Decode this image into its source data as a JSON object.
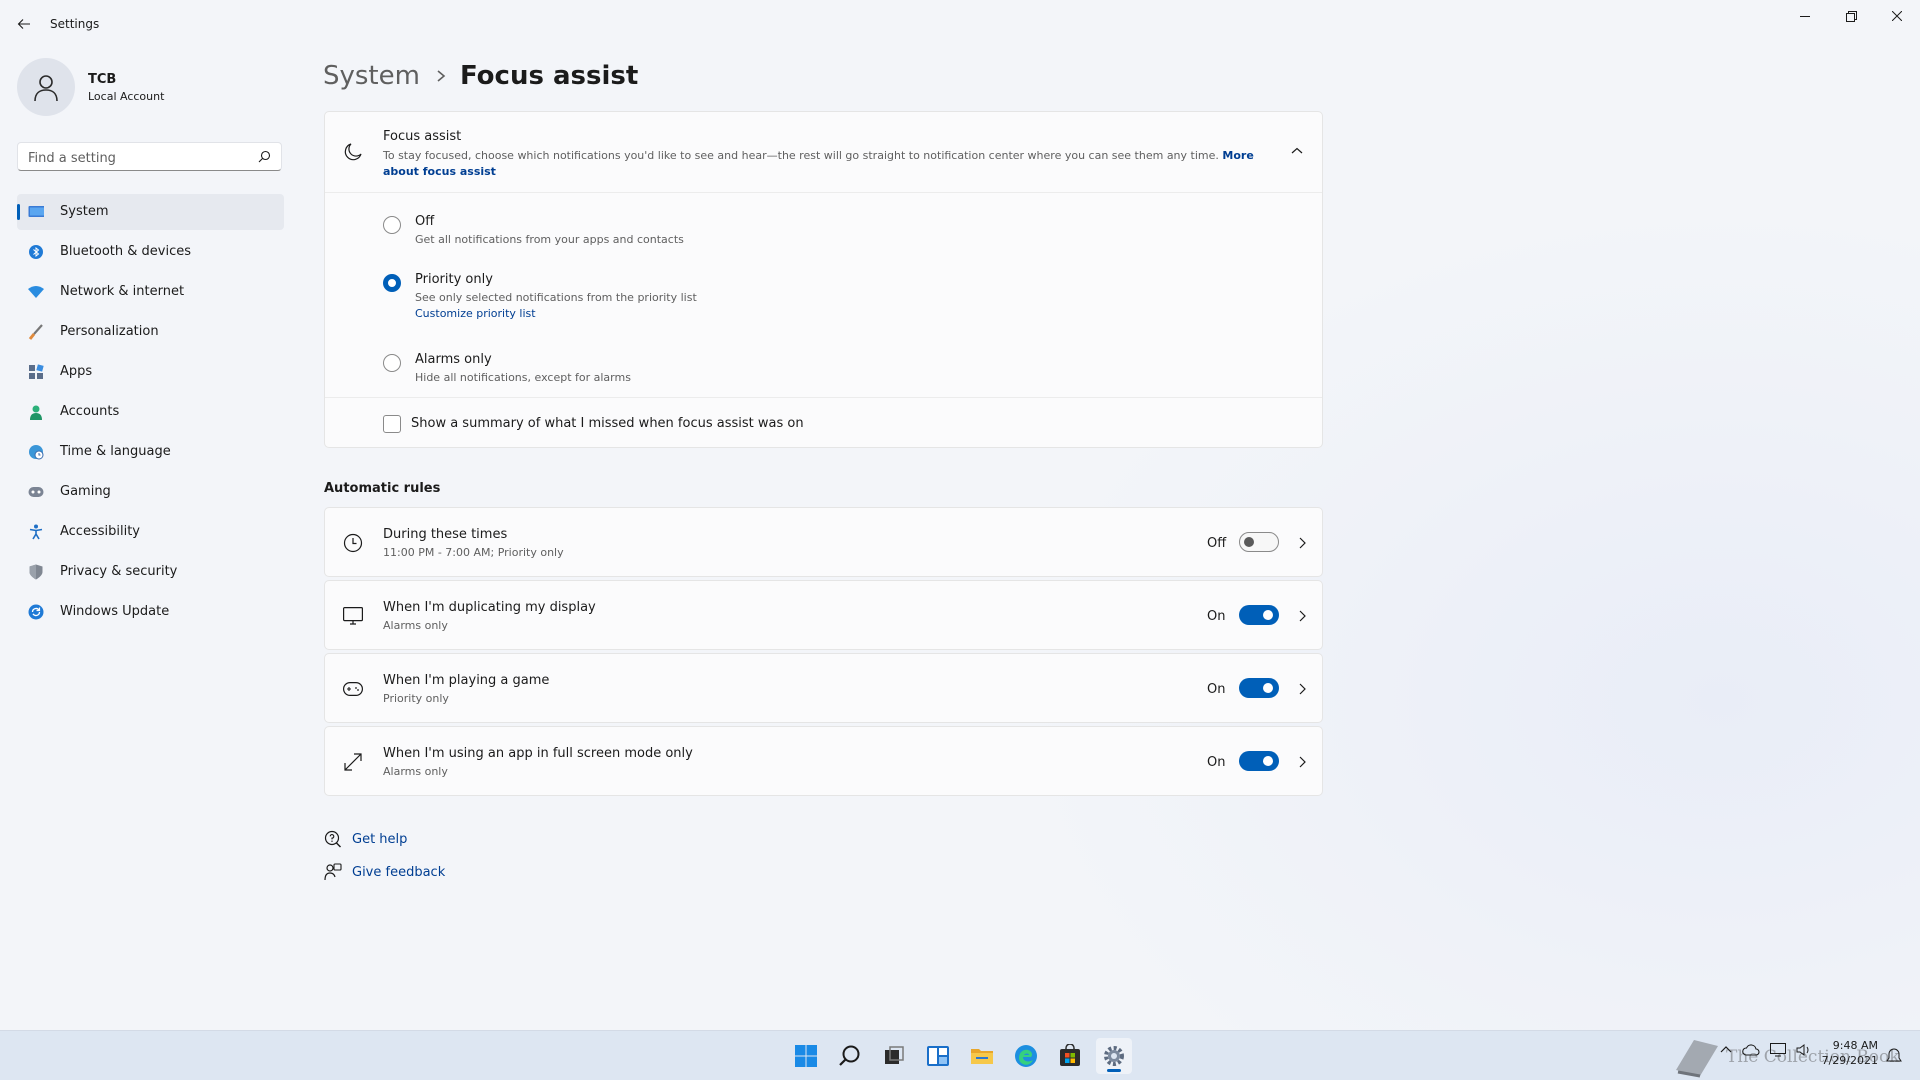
{
  "window": {
    "app_title": "Settings"
  },
  "user": {
    "name": "TCB",
    "account_type": "Local Account"
  },
  "search": {
    "placeholder": "Find a setting",
    "value": ""
  },
  "sidebar": {
    "items": [
      {
        "label": "System",
        "icon": "monitor-icon",
        "selected": true
      },
      {
        "label": "Bluetooth & devices",
        "icon": "bluetooth-icon"
      },
      {
        "label": "Network & internet",
        "icon": "wifi-icon"
      },
      {
        "label": "Personalization",
        "icon": "paintbrush-icon"
      },
      {
        "label": "Apps",
        "icon": "apps-icon"
      },
      {
        "label": "Accounts",
        "icon": "person-icon"
      },
      {
        "label": "Time & language",
        "icon": "globe-clock-icon"
      },
      {
        "label": "Gaming",
        "icon": "gamepad-icon"
      },
      {
        "label": "Accessibility",
        "icon": "accessibility-icon"
      },
      {
        "label": "Privacy & security",
        "icon": "shield-icon"
      },
      {
        "label": "Windows Update",
        "icon": "update-icon"
      }
    ]
  },
  "breadcrumb": {
    "parent": "System",
    "separator": "›",
    "current": "Focus assist"
  },
  "focus_assist": {
    "title": "Focus assist",
    "description": "To stay focused, choose which notifications you'd like to see and hear—the rest will go straight to notification center where you can see them any time.",
    "more_link": "More about focus assist",
    "options": [
      {
        "label": "Off",
        "sub": "Get all notifications from your apps and contacts",
        "checked": false
      },
      {
        "label": "Priority only",
        "sub": "See only selected notifications from the priority list",
        "checked": true
      },
      {
        "label": "Alarms only",
        "sub": "Hide all notifications, except for alarms",
        "checked": false
      }
    ],
    "customize_link": "Customize priority list",
    "summary_label": "Show a summary of what I missed when focus assist was on",
    "summary_checked": false
  },
  "automatic_rules": {
    "heading": "Automatic rules",
    "rules": [
      {
        "title": "During these times",
        "sub": "11:00 PM - 7:00 AM; Priority only",
        "state": "Off",
        "on": false,
        "icon": "clock-icon"
      },
      {
        "title": "When I'm duplicating my display",
        "sub": "Alarms only",
        "state": "On",
        "on": true,
        "icon": "display-icon"
      },
      {
        "title": "When I'm playing a game",
        "sub": "Priority only",
        "state": "On",
        "on": true,
        "icon": "gamepad-icon"
      },
      {
        "title": "When I'm using an app in full screen mode only",
        "sub": "Alarms only",
        "state": "On",
        "on": true,
        "icon": "fullscreen-icon"
      }
    ]
  },
  "help": {
    "get_help": "Get help",
    "give_feedback": "Give feedback"
  },
  "taskbar": {
    "apps": [
      "start-icon",
      "search-icon",
      "task-view-icon",
      "widgets-icon",
      "file-explorer-icon",
      "edge-icon",
      "store-icon",
      "settings-icon"
    ],
    "time": "9:48 AM",
    "date": "7/29/2021",
    "watermark": "The Collection Book"
  },
  "colors": {
    "accent": "#005fb8",
    "link": "#003e92"
  }
}
